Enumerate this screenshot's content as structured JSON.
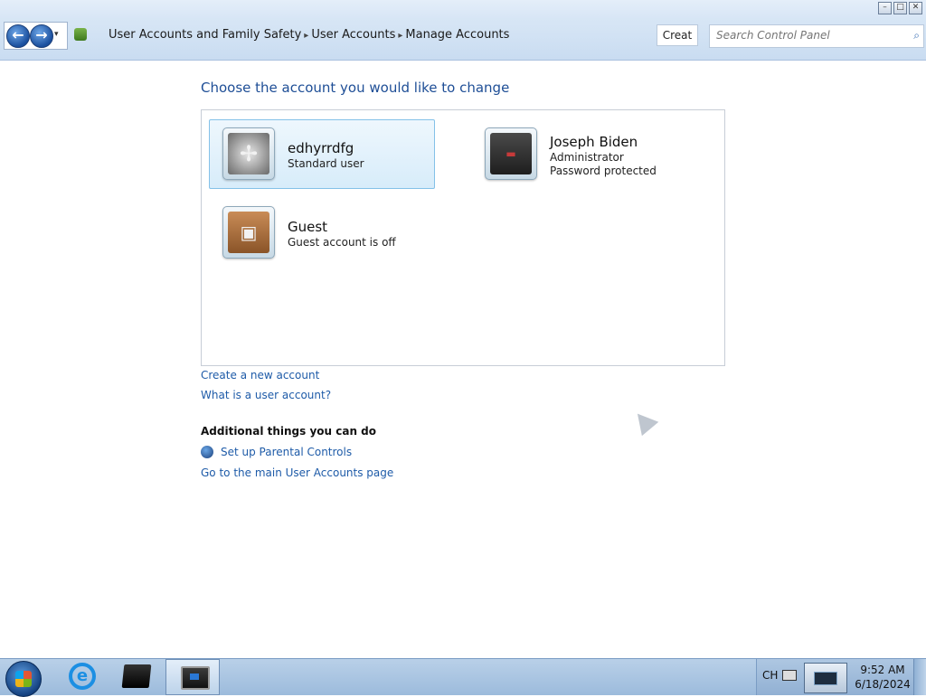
{
  "window": {
    "controls": [
      "minimize",
      "maximize",
      "close"
    ]
  },
  "nav": {
    "back_icon": "back-arrow-icon",
    "forward_icon": "forward-arrow-icon"
  },
  "address": {
    "crumbs": [
      "User Accounts and Family Safety",
      "User Accounts",
      "Manage Accounts"
    ]
  },
  "toolbar": {
    "refresh_label": "Creat"
  },
  "search": {
    "placeholder": "Search Control Panel"
  },
  "main": {
    "heading": "Choose the account you would like to change",
    "accounts": [
      {
        "name": "edhyrrdfg",
        "line1": "Standard user",
        "line2": "",
        "picture": "tools-icon",
        "selected": true
      },
      {
        "name": "Joseph Biden",
        "line1": "Administrator",
        "line2": "Password protected",
        "picture": "screen-icon",
        "selected": false
      },
      {
        "name": "Guest",
        "line1": "Guest account is off",
        "line2": "",
        "picture": "briefcase-icon",
        "selected": false
      }
    ],
    "links": {
      "create_account": "Create a new account",
      "what_is_account": "What is a user account?"
    },
    "additional": {
      "heading": "Additional things you can do",
      "parental_controls": "Set up Parental Controls",
      "main_accounts_page": "Go to the main User Accounts page"
    }
  },
  "taskbar": {
    "language": "CH",
    "time": "9:52 AM",
    "date": "6/18/2024"
  },
  "colors": {
    "link": "#1e5ba8",
    "heading": "#1e4e96",
    "selection_fill": "#d7ecfa",
    "selection_border": "#84c1e8"
  }
}
